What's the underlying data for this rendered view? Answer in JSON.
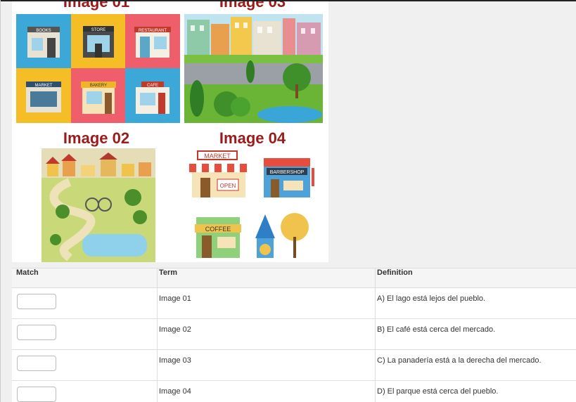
{
  "figure": {
    "headings": [
      "Image 01",
      "Image 03",
      "Image 02",
      "Image 04"
    ],
    "image01": {
      "signs": [
        "BOOKS",
        "STORE",
        "RESTAURANT",
        "MARKET",
        "BAKERY",
        "CAFE"
      ]
    },
    "image04": {
      "signs": [
        "MARKET",
        "OPEN",
        "BARBERSHOP",
        "COFFEE"
      ]
    }
  },
  "table": {
    "headers": {
      "match": "Match",
      "term": "Term",
      "definition": "Definition"
    },
    "rows": [
      {
        "term": "Image 01",
        "definition": "A) El lago está lejos del pueblo.",
        "match": ""
      },
      {
        "term": "Image 02",
        "definition": "B) El café está cerca del mercado.",
        "match": ""
      },
      {
        "term": "Image 03",
        "definition": "C) La panadería está a la derecha del mercado.",
        "match": ""
      },
      {
        "term": "Image 04",
        "definition": "D) El parque está cerca del pueblo.",
        "match": ""
      }
    ]
  },
  "colors": {
    "heading": "#9b1b1b",
    "border": "#dddddd"
  }
}
